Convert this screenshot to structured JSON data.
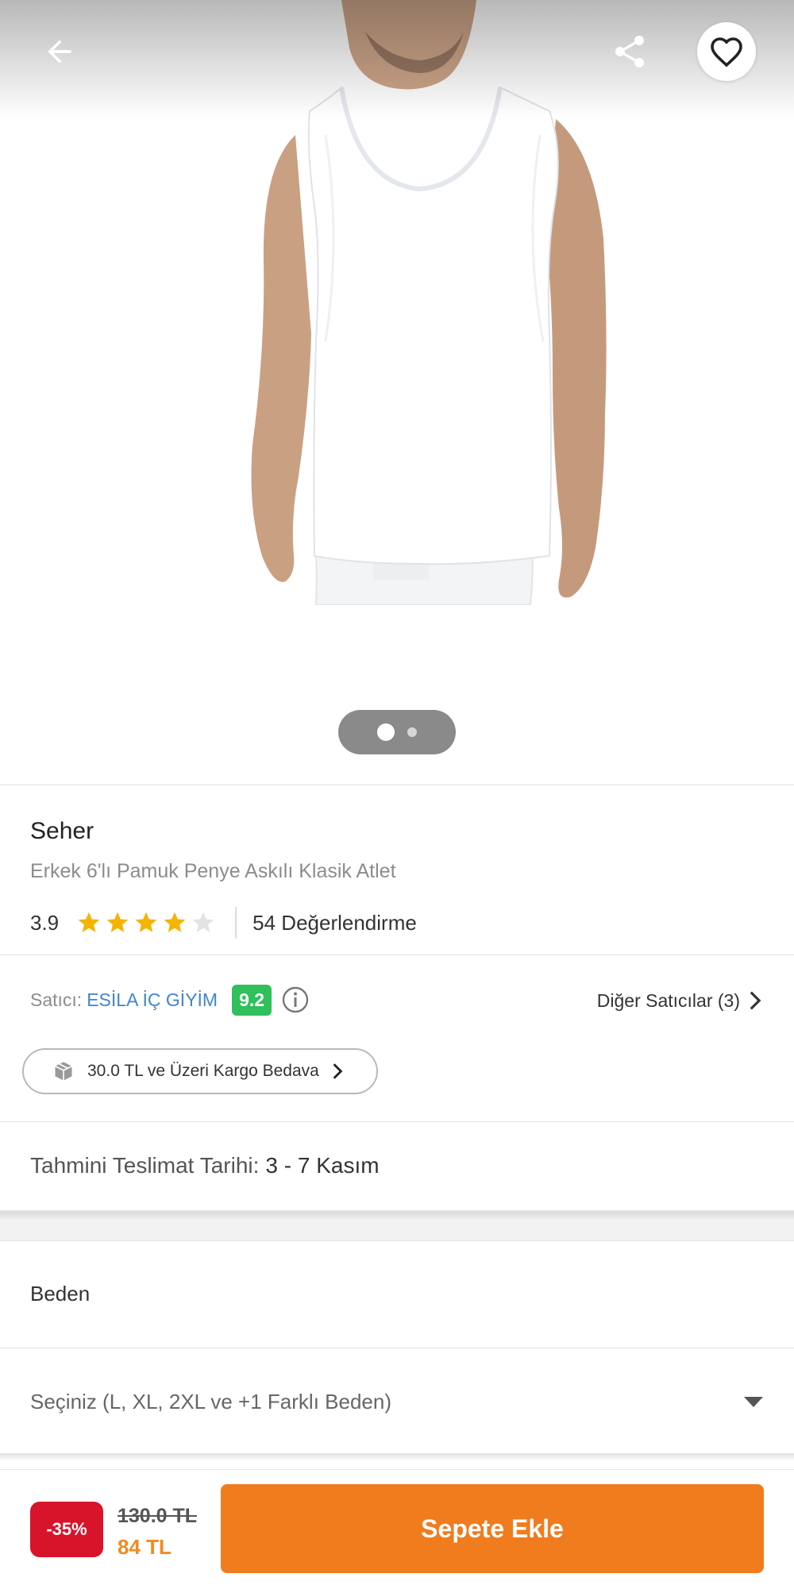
{
  "header": {
    "back_icon": "arrow-left-icon",
    "share_icon": "share-icon",
    "favorite_icon": "heart-outline-icon"
  },
  "gallery": {
    "current_page": 1,
    "total_pages": 2
  },
  "product": {
    "brand": "Seher",
    "name": "Erkek 6'lı Pamuk Penye Askılı Klasik Atlet",
    "rating": "3.9",
    "rating_value": 3.9,
    "review_count": "54 Değerlendirme"
  },
  "seller": {
    "prefix": "Satıcı:",
    "name": "ESİLA İÇ GİYİM",
    "score": "9.2",
    "other_sellers": "Diğer Satıcılar (3)"
  },
  "shipping": {
    "label": "30.0 TL ve Üzeri Kargo Bedava"
  },
  "delivery": {
    "label": "Tahmini Teslimat Tarihi:",
    "value": "3 - 7 Kasım"
  },
  "size": {
    "title": "Beden",
    "placeholder": "Seçiniz (L, XL, 2XL ve +1 Farklı Beden)"
  },
  "price": {
    "discount": "-35%",
    "old": "130.0 TL",
    "current": "84 TL"
  },
  "cta": {
    "add_to_cart": "Sepete Ekle"
  },
  "colors": {
    "accent": "#f07c1e",
    "discount": "#d8142b",
    "seller_link": "#3e86d1",
    "score": "#2fbf5b",
    "star": "#f5b400"
  }
}
